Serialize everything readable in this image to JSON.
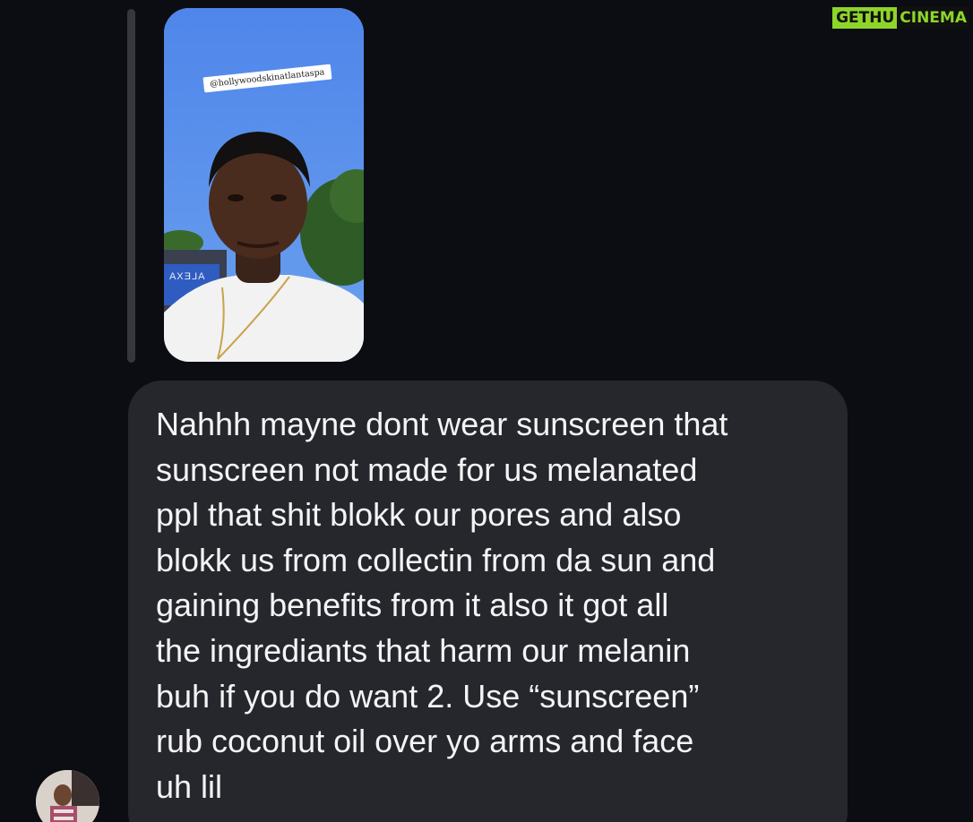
{
  "watermark": {
    "part1": "GETHU",
    "part2": "CINEMA",
    "accent_color": "#8ed52a"
  },
  "story": {
    "mention_tag": "@hollywoodskinatlantaspa",
    "store_sign": "ALEXA"
  },
  "message": {
    "lines": [
      "Nahhh mayne dont wear sunscreen that",
      "sunscreen not made for us melanated",
      "ppl that shit blokk our pores and also",
      "blokk us from collectin from da sun and",
      "gaining benefits from it also it got all",
      "the ingrediants that harm our melanin",
      "buh if you do want 2. Use “sunscreen”",
      "rub coconut oil over yo arms and face",
      "uh lil"
    ],
    "bubble_color": "#26272c",
    "text_color": "#f4f4f6"
  },
  "theme": {
    "background": "#0b0d12",
    "reply_bar_color": "#35373c"
  },
  "avatar": {
    "icon": "sender-avatar"
  }
}
